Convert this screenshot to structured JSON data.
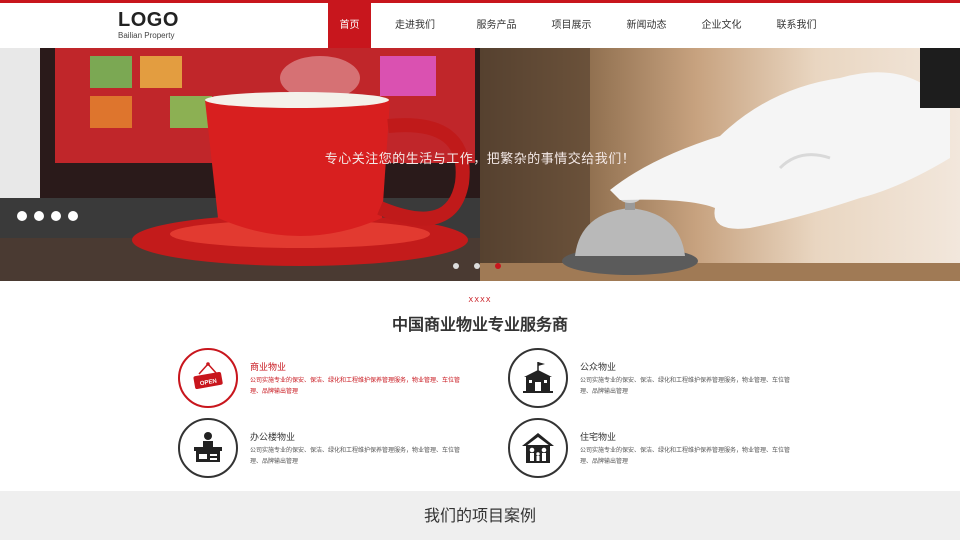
{
  "header": {
    "logo_main": "LOGO",
    "logo_sub": "Bailian Property",
    "nav": [
      {
        "label": "首页",
        "active": true
      },
      {
        "label": "走进我们",
        "active": false
      },
      {
        "label": "服务产品",
        "active": false
      },
      {
        "label": "项目展示",
        "active": false
      },
      {
        "label": "新闻动态",
        "active": false
      },
      {
        "label": "企业文化",
        "active": false
      },
      {
        "label": "联系我们",
        "active": false
      }
    ]
  },
  "banner": {
    "caption": "专心关注您的生活与工作，把繁杂的事情交给我们！",
    "left_slides_count": 4,
    "right_slides_count": 3,
    "right_active_index": 2
  },
  "services": {
    "tag": "XXXX",
    "title": "中国商业物业专业服务商",
    "items": [
      {
        "title": "商业物业",
        "desc": "公司实施专业的保安、保洁、绿化和工程维护保养管理服务，物业管理、车位管理、品牌输出管理",
        "icon": "open-sign-icon"
      },
      {
        "title": "公众物业",
        "desc": "公司实施专业的保安、保洁、绿化和工程维护保养管理服务，物业管理、车位管理、品牌输出管理",
        "icon": "public-building-icon"
      },
      {
        "title": "办公楼物业",
        "desc": "公司实施专业的保安、保洁、绿化和工程维护保养管理服务，物业管理、车位管理、品牌输出管理",
        "icon": "office-desk-icon"
      },
      {
        "title": "住宅物业",
        "desc": "公司实施专业的保安、保洁、绿化和工程维护保养管理服务，物业管理、车位管理、品牌输出管理",
        "icon": "family-home-icon"
      }
    ]
  },
  "projects": {
    "title": "我们的项目案例"
  },
  "colors": {
    "accent": "#c8161d",
    "text": "#333333",
    "section_bg": "#efefef"
  }
}
